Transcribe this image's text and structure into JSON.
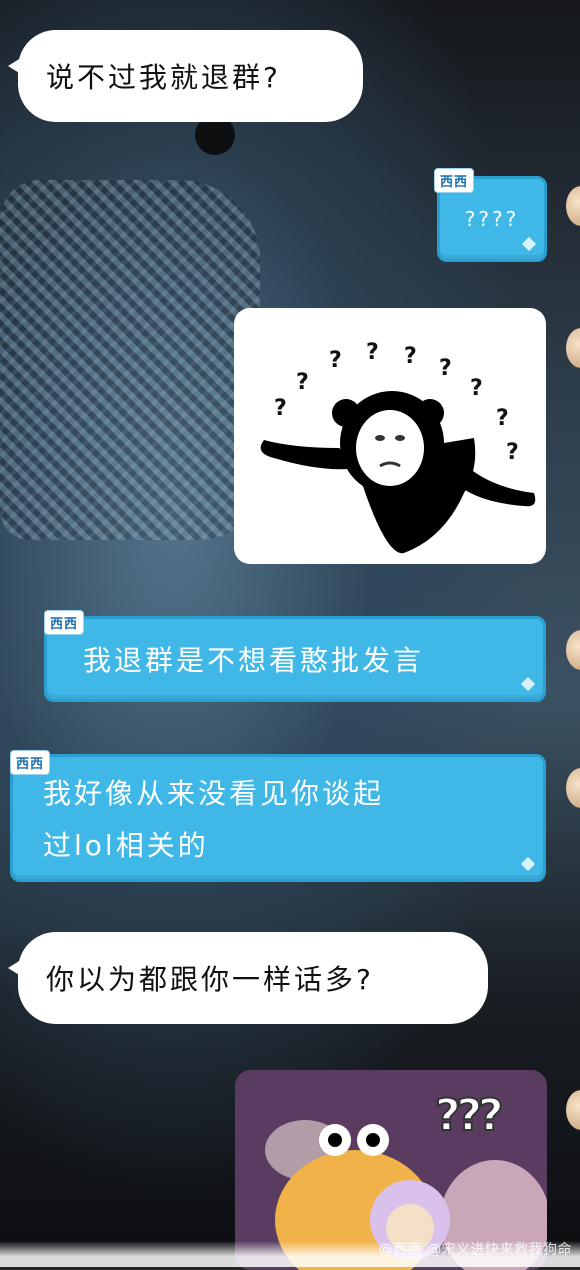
{
  "messages": [
    {
      "text": "说不过我就退群?"
    },
    {
      "tag": "西西",
      "text": "????"
    },
    {
      "sticker": "panda-confused"
    },
    {
      "tag": "西西",
      "text": "我退群是不想看憨批发言"
    },
    {
      "tag": "西西",
      "line1": "我好像从来没看见你谈起",
      "line2": "过lol相关的"
    },
    {
      "text": "你以为都跟你一样话多?"
    },
    {
      "sticker": "chick-confused"
    }
  ],
  "sticker_question_marks": [
    "?",
    "?",
    "?",
    "?",
    "?",
    "?",
    "?",
    "?",
    "?"
  ],
  "sticker2_marks": "???",
  "watermark": "@西西 @宋义进快来救我狗命",
  "colors": {
    "blue_bubble": "#3fb8e8",
    "white_bubble": "#ffffff"
  }
}
